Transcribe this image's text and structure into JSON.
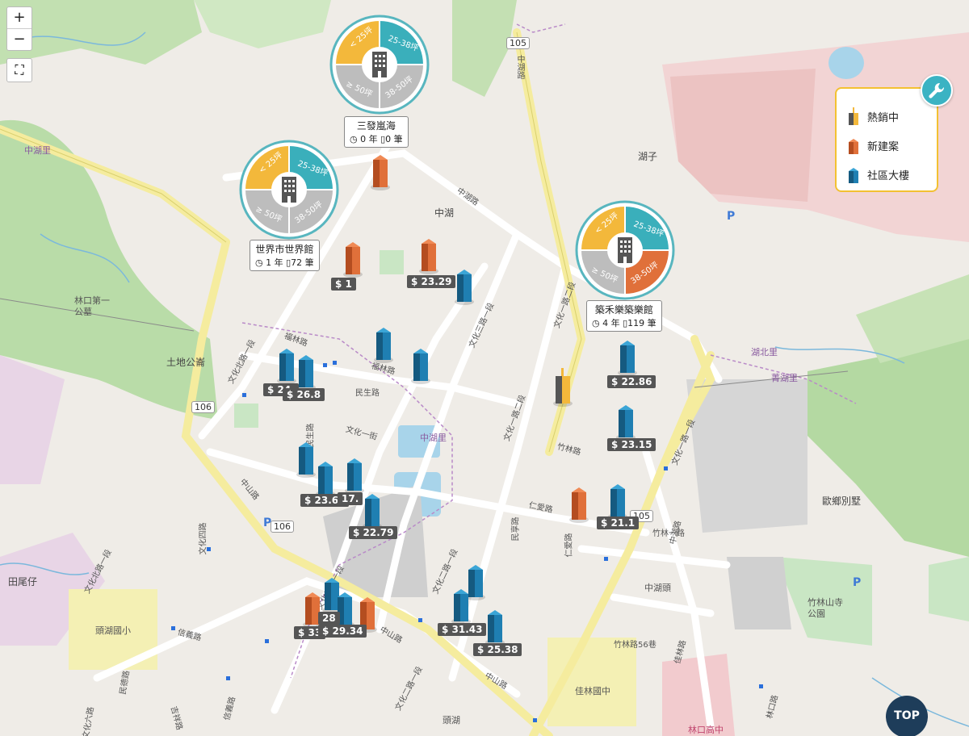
{
  "controls": {
    "zoom_in": "+",
    "zoom_out": "−",
    "fullscreen": "⛶"
  },
  "clusters": [
    {
      "name": "三發嵐海",
      "years": "0 年",
      "count": "0 筆",
      "quadrants": [
        "< 25坪",
        "25-38坪",
        "≥ 50坪",
        "38-50坪"
      ],
      "colors": [
        "#f3b83b",
        "#3aafbb",
        "#bdbdbd",
        "#bdbdbd"
      ]
    },
    {
      "name": "世界市世界館",
      "years": "1 年",
      "count": "72 筆",
      "quadrants": [
        "< 25坪",
        "25-38坪",
        "≥ 50坪",
        "38-50坪"
      ],
      "colors": [
        "#f3b83b",
        "#3aafbb",
        "#bdbdbd",
        "#bdbdbd"
      ]
    },
    {
      "name": "築禾樂築樂館",
      "years": "4 年",
      "count": "119 筆",
      "quadrants": [
        "< 25坪",
        "25-38坪",
        "≥ 50坪",
        "38-50坪"
      ],
      "colors": [
        "#f3b83b",
        "#3aafbb",
        "#bdbdbd",
        "#e0703a"
      ]
    }
  ],
  "prices": [
    "$ 23.29",
    "$ 24.",
    "$ 26.8",
    "$ 22.86",
    "$ 23.15",
    "$ 23.69",
    "$ 22.79",
    "$ 21.1",
    "$ 31.43",
    "$ 25.38",
    "$ 33",
    "$ 29.34",
    "$ 1",
    "17.",
    "28"
  ],
  "legend": {
    "items": [
      {
        "label": "熱銷中",
        "color": "#f3b83b"
      },
      {
        "label": "新建案",
        "color": "#e0703a"
      },
      {
        "label": "社區大樓",
        "color": "#1f7fb2"
      }
    ]
  },
  "places": {
    "zhonghu": "中湖",
    "huzi": "湖子",
    "tudigong": "土地公崙",
    "linkou_park": "林口第一公墓",
    "tianweizi": "田尾仔",
    "touhu_school": "頭湖國小",
    "jialin_school": "佳林國中",
    "ouxiang": "歐鄉別墅",
    "zhonghutou": "中湖頭",
    "zhulin_temple": "竹林山寺公園",
    "touhu": "頭湖",
    "huzhou_village": "湖北里",
    "zhonghu_village": "中湖里",
    "zhonghu_village2": "中湖里",
    "jinhu": "菁湖里",
    "linkou_gate": "林口高中"
  },
  "roads": {
    "r105a": "105",
    "r105b": "105",
    "r106a": "106",
    "r106b": "106",
    "zhonghu_rd": "中湖路",
    "zhonghu_rd2": "中湖路",
    "zhongshan_rd": "中山路",
    "zhongshan_rd2": "中山路",
    "zhongshan_rd3": "中山路",
    "wenhua_north": "文化北路一段",
    "wenhua_north2": "文化北路一段",
    "wenhua3": "文化三路一段",
    "wenhua3b": "文化三路一段",
    "wenhua2": "文化二路一段",
    "wenhua2b": "文化二路一段",
    "wenhua1": "文化一路二段",
    "wenhua1b": "文化一路二段",
    "wenhua1c": "文化一路一段",
    "fulin": "福林路",
    "fulin2": "福林路",
    "minsheng": "民生路",
    "minsheng2": "民生路",
    "wenhua_1st": "文化一街",
    "renai": "仁愛路",
    "renai2": "仁愛路",
    "zhulin": "竹林路",
    "zhulin1": "竹林一路",
    "xinyi": "信義路",
    "xinyi2": "信義路",
    "jili": "吉祥路",
    "linkou_rd": "林口路",
    "zhonghu_rd3": "中湖路",
    "jialin": "佳林路",
    "wenhua4": "文化四路",
    "minde": "民德路",
    "minxiang": "民享路",
    "wenhua6": "文化六路",
    "zhulin56": "竹林路56巷"
  },
  "top_button": "TOP",
  "parking": "P"
}
